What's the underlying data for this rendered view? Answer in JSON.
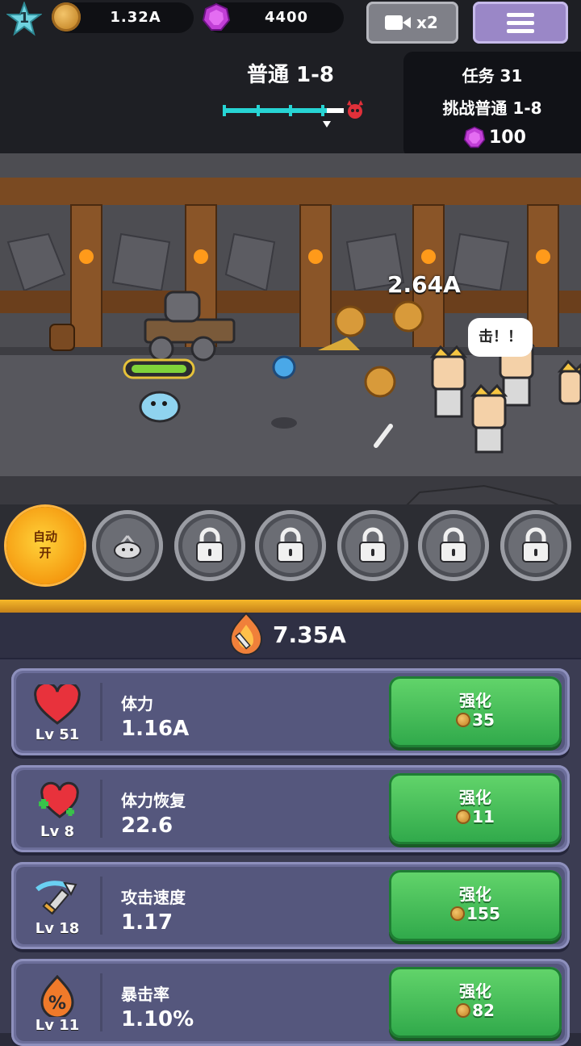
{
  "top": {
    "player_level": "1",
    "coins": "1.32A",
    "gems": "4400",
    "video_badge": "x2"
  },
  "stage": {
    "title": "普通 1-8",
    "progress_fraction": 0.86
  },
  "quest": {
    "title": "任务 31",
    "desc": "挑战普通 1-8",
    "reward": "100"
  },
  "battle": {
    "damage_popup": "2.64A",
    "enemy_shout": "击！！"
  },
  "skills": {
    "auto_label_1": "自动",
    "auto_label_2": "开",
    "slots": [
      "unlocked",
      "locked",
      "locked",
      "locked",
      "locked",
      "locked"
    ]
  },
  "power": "7.35A",
  "upgrades": [
    {
      "name": "体力",
      "value": "1.16A",
      "level": "Lv 51",
      "button": "强化",
      "cost": "35",
      "icon": "heart-icon"
    },
    {
      "name": "体力恢复",
      "value": "22.6",
      "level": "Lv 8",
      "button": "强化",
      "cost": "11",
      "icon": "heart-plus-icon"
    },
    {
      "name": "攻击速度",
      "value": "1.17",
      "level": "Lv 18",
      "button": "强化",
      "cost": "155",
      "icon": "sword-speed-icon"
    },
    {
      "name": "暴击率",
      "value": "1.10%",
      "level": "Lv 11",
      "button": "强化",
      "cost": "82",
      "icon": "crit-flame-icon"
    }
  ],
  "colors": {
    "upgrade_green": "#3fbf55",
    "panel": "#55577d",
    "accent_gold": "#f6b82a",
    "progress_cyan": "#27d4d4"
  }
}
